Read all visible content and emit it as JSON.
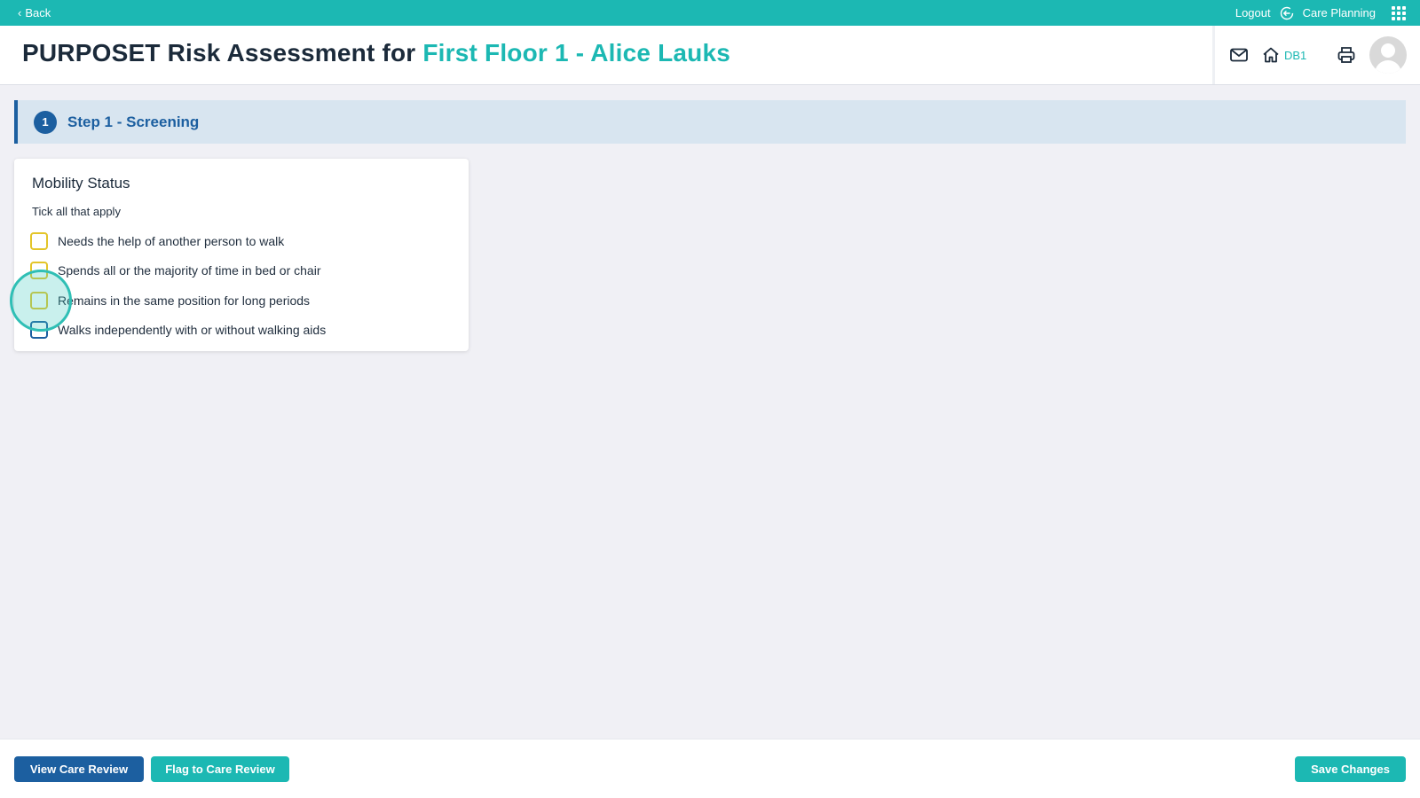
{
  "topbar": {
    "back_label": "Back",
    "logout_label": "Logout",
    "app_label": "Care Planning"
  },
  "header": {
    "title_prefix": "PURPOSET Risk Assessment for ",
    "title_accent": "First Floor 1 - Alice Lauks",
    "home_code": "DB1"
  },
  "step": {
    "number": "1",
    "label": "Step 1 - Screening"
  },
  "mobility": {
    "title": "Mobility Status",
    "hint": "Tick all that apply",
    "options": [
      {
        "label": "Needs the help of another person to walk",
        "checked": false
      },
      {
        "label": "Spends all or the majority of time in bed or chair",
        "checked": false
      },
      {
        "label": "Remains in the same position for long periods",
        "checked": false
      },
      {
        "label": "Walks independently with or without walking aids",
        "checked": false
      }
    ]
  },
  "footer": {
    "view_label": "View Care Review",
    "flag_label": "Flag to Care Review",
    "save_label": "Save Changes"
  },
  "colors": {
    "accent_teal": "#1cb8b3",
    "primary_blue": "#1c5fa0",
    "checkbox_yellow": "#e3c52a"
  }
}
